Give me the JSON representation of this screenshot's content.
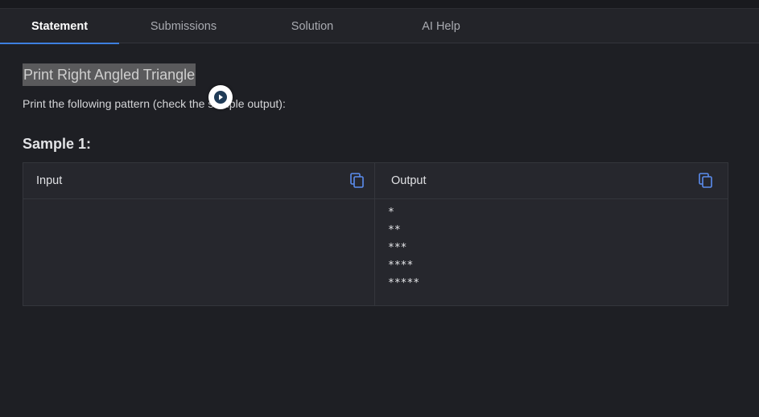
{
  "tabs": [
    {
      "label": "Statement",
      "active": true
    },
    {
      "label": "Submissions",
      "active": false
    },
    {
      "label": "Solution",
      "active": false
    },
    {
      "label": "AI Help",
      "active": false
    }
  ],
  "problem": {
    "title": "Print Right Angled Triangle",
    "description": "Print the following pattern (check the sample output):"
  },
  "sample": {
    "heading": "Sample 1:",
    "input_label": "Input",
    "output_label": "Output",
    "input_lines": [],
    "output_lines": [
      "*",
      "**",
      "***",
      "****",
      "*****"
    ]
  },
  "colors": {
    "accent": "#3d7fe0",
    "copy_icon": "#5b8def"
  },
  "icons": [
    "copy-icon",
    "play-icon"
  ]
}
